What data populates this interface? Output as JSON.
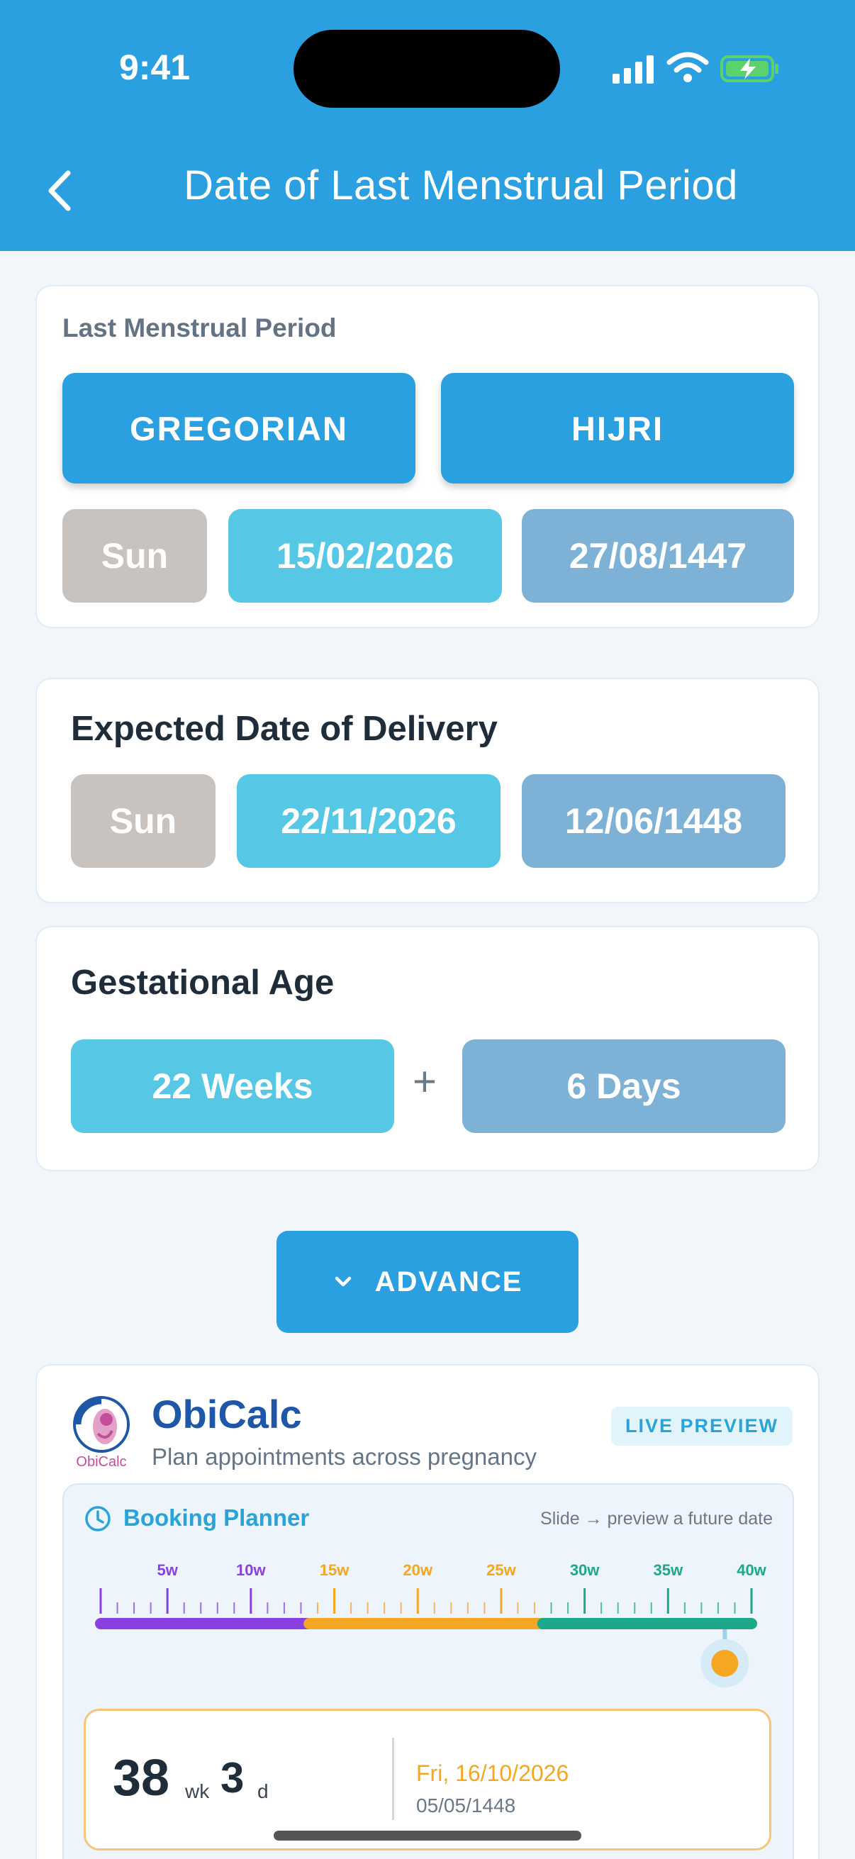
{
  "status_bar": {
    "time": "9:41"
  },
  "header": {
    "title": "Date of Last Menstrual Period"
  },
  "lmp": {
    "label": "Last Menstrual Period",
    "gregorian_button": "GREGORIAN",
    "hijri_button": "HIJRI",
    "day": "Sun",
    "gregorian_date": "15/02/2026",
    "hijri_date": "27/08/1447"
  },
  "edd": {
    "title": "Expected Date of Delivery",
    "day": "Sun",
    "gregorian_date": "22/11/2026",
    "hijri_date": "12/06/1448"
  },
  "ga": {
    "title": "Gestational Age",
    "weeks": "22 Weeks",
    "plus": "+",
    "days": "6 Days"
  },
  "advance": {
    "label": "ADVANCE"
  },
  "obicalc": {
    "logo_text": "ObiCalc",
    "name": "ObiCalc",
    "subtitle": "Plan appointments across pregnancy",
    "badge": "LIVE PREVIEW",
    "planner": {
      "title": "Booking Planner",
      "hint": "Slide → preview a future date",
      "ticks": [
        "5w",
        "10w",
        "15w",
        "20w",
        "25w",
        "30w",
        "35w",
        "40w"
      ],
      "slider_value_weeks": 38.4,
      "colors": {
        "first": "#8a3fe0",
        "second": "#f5a623",
        "third": "#1ea88a"
      },
      "result": {
        "weeks": "38",
        "weeks_unit": "wk",
        "days": "3",
        "days_unit": "d",
        "date": "Fri, 16/10/2026",
        "hijri_date": "05/05/1448"
      }
    }
  }
}
